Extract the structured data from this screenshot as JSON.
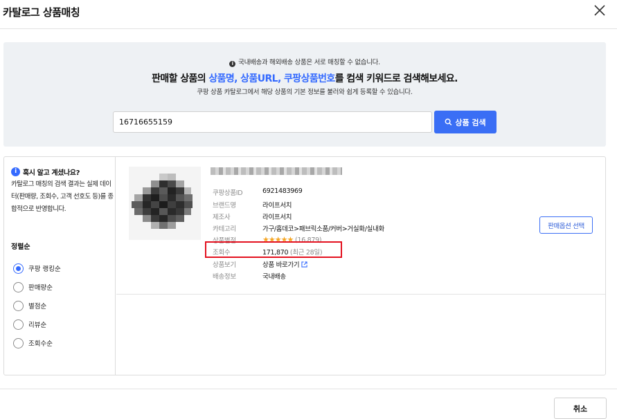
{
  "modal": {
    "title": "카탈로그 상품매칭"
  },
  "search": {
    "notice": "국내배송과 해외배송 상품은 서로 매칭할 수 없습니다.",
    "headline_prefix": "판매할 상품의 ",
    "headline_hl1": "상품명, 상품URL, 쿠팡상품번호",
    "headline_suffix": "를 컴색 키워드로 검색해보세요.",
    "subline": "쿠팡 상품 카탈로그에서 해당 상품의 기본 정보를 불러와 쉽게 등록할 수 있습니다.",
    "input_value": "16716655159",
    "button_label": "상품 검색"
  },
  "sidebar": {
    "tip_title": "혹시 알고 계셨나요?",
    "tip_body": "카탈로그 매칭의 검색 결과는 실제 데이터(판매량, 조회수, 고객 선호도 등)를 종합적으로 반영합니다.",
    "sort_title": "정렬순",
    "sort_options": [
      {
        "label": "쿠팡 랭킹순",
        "selected": true
      },
      {
        "label": "판매량순",
        "selected": false
      },
      {
        "label": "별점순",
        "selected": false
      },
      {
        "label": "리뷰순",
        "selected": false
      },
      {
        "label": "조회수순",
        "selected": false
      }
    ]
  },
  "product": {
    "fields": {
      "id_label": "쿠팡상품ID",
      "id_value": "6921483969",
      "brand_label": "브랜드명",
      "brand_value": "라이프서치",
      "maker_label": "제조사",
      "maker_value": "라이프서치",
      "category_label": "카테고리",
      "category_value": "가구/홈데코>패브릭소품/커버>거실화/실내화",
      "rating_label": "상품별점",
      "rating_stars": 4.5,
      "rating_count": "(16,879)",
      "views_label": "조회수",
      "views_value": "171,870",
      "views_period": "(최근 28일)",
      "view_label": "상품보기",
      "view_link": "상품 바로가기",
      "delivery_label": "배송정보",
      "delivery_value": "국내배송"
    },
    "option_button": "판매옵션 선택"
  },
  "footer": {
    "cancel_label": "취소"
  },
  "colors": {
    "accent": "#346aff",
    "button": "#3a6ef5",
    "highlight": "#e3101e",
    "star": "#f5a623"
  }
}
